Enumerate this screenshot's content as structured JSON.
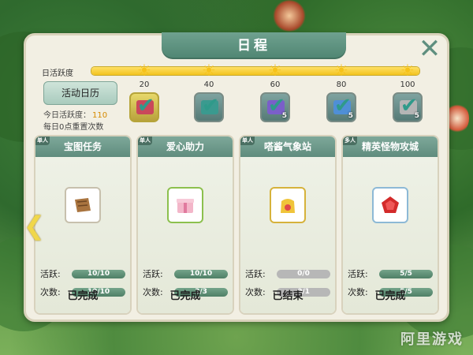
{
  "panel": {
    "title": "日程",
    "close_icon": "close-x-icon"
  },
  "activity": {
    "label": "日活跃度",
    "progress_percent": 100,
    "milestones": [
      "20",
      "40",
      "60",
      "80",
      "100"
    ],
    "calendar_button": "活动日历",
    "today_label": "今日活跃度：",
    "today_value": "110",
    "reset_text": "每日0点重置次数"
  },
  "rewards": [
    {
      "icon": "gift-box-icon",
      "claimed": true,
      "count": ""
    },
    {
      "icon": "gift-box-icon",
      "claimed": true,
      "count": ""
    },
    {
      "icon": "gift-box-icon",
      "claimed": true,
      "count": "5"
    },
    {
      "icon": "gift-box-icon",
      "claimed": true,
      "count": "5"
    },
    {
      "icon": "gift-box-icon",
      "claimed": true,
      "count": "5"
    }
  ],
  "cards": [
    {
      "badge": "单人",
      "title": "宝图任务",
      "icon": "treasure-map-icon",
      "active_label": "活跃:",
      "active_value": "10/10",
      "active_fraction": 1,
      "times_label": "次数:",
      "times_value": "10/10",
      "times_fraction": 1,
      "status": "已完成"
    },
    {
      "badge": "单人",
      "title": "爱心助力",
      "icon": "pink-gift-icon",
      "active_label": "活跃:",
      "active_value": "10/10",
      "active_fraction": 1,
      "times_label": "次数:",
      "times_value": "3/3",
      "times_fraction": 1,
      "status": "已完成"
    },
    {
      "badge": "单人",
      "title": "嗒酱气象站",
      "icon": "lucky-bag-icon",
      "active_label": "活跃:",
      "active_value": "0/0",
      "active_fraction": 0,
      "times_label": "次数:",
      "times_value": "0/1",
      "times_fraction": 0,
      "status": "已结束"
    },
    {
      "badge": "多人",
      "title": "精英怪物攻城",
      "icon": "red-gem-icon",
      "active_label": "活跃:",
      "active_value": "5/5",
      "active_fraction": 1,
      "times_label": "次数:",
      "times_value": "5/5",
      "times_fraction": 1,
      "status": "已完成"
    }
  ],
  "nav": {
    "left_arrow": "chevron-left-icon"
  },
  "watermark": "阿里游戏"
}
